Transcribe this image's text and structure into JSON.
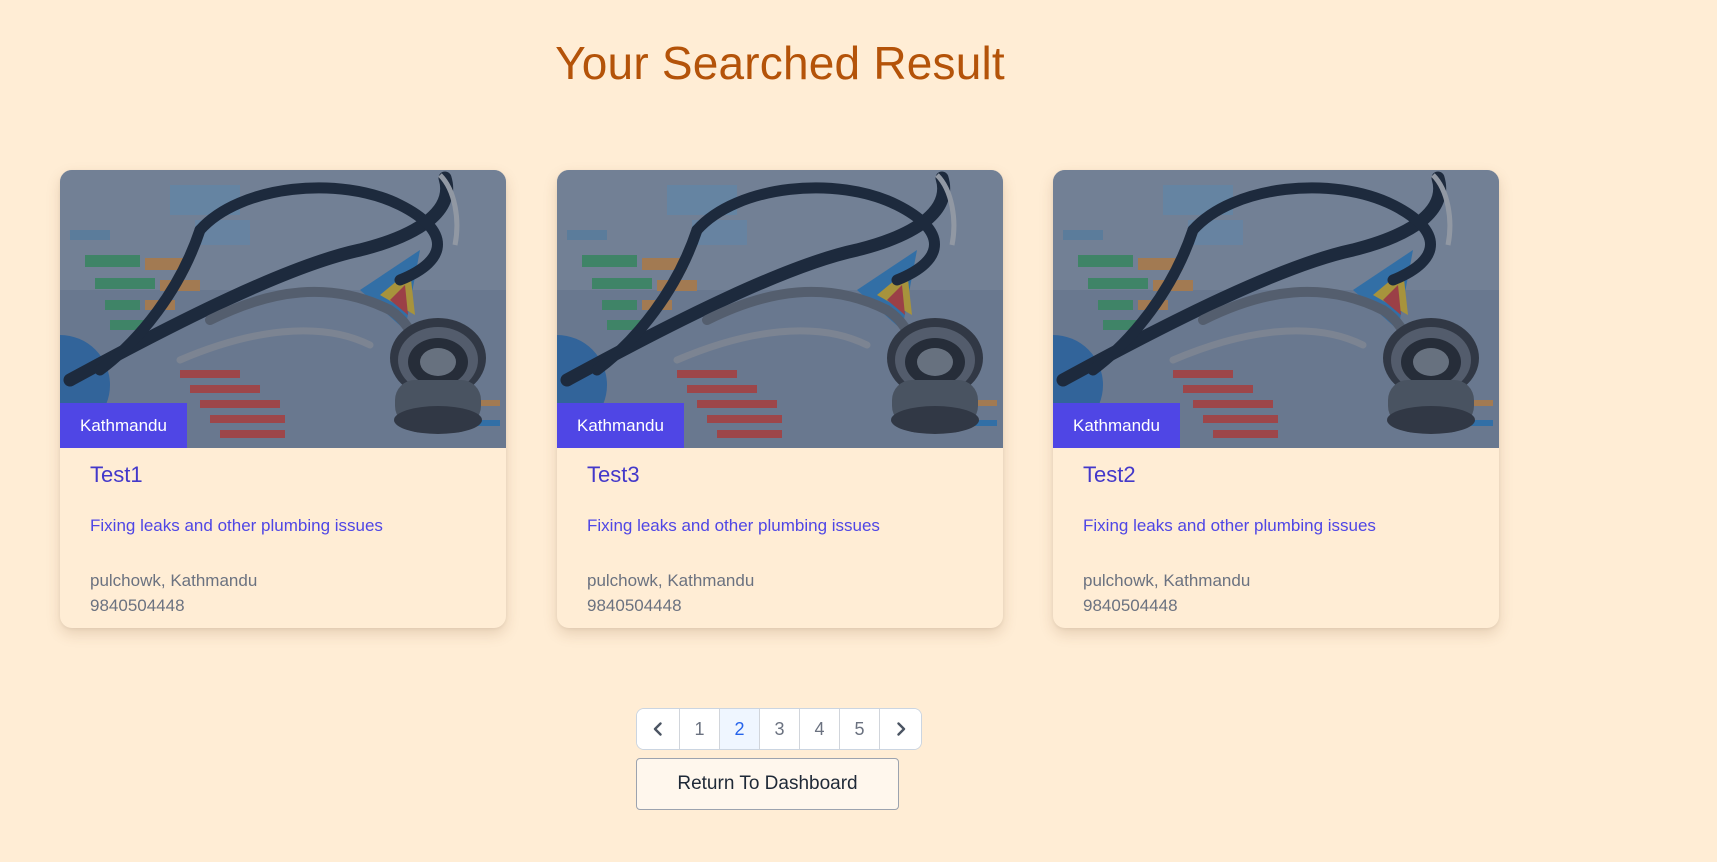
{
  "header": {
    "title": "Your Searched Result"
  },
  "results": [
    {
      "badge": "Kathmandu",
      "title": "Test1",
      "description": "Fixing leaks and other plumbing issues",
      "address": "pulchowk, Kathmandu",
      "phone": "9840504448"
    },
    {
      "badge": "Kathmandu",
      "title": "Test3",
      "description": "Fixing leaks and other plumbing issues",
      "address": "pulchowk, Kathmandu",
      "phone": "9840504448"
    },
    {
      "badge": "Kathmandu",
      "title": "Test2",
      "description": "Fixing leaks and other plumbing issues",
      "address": "pulchowk, Kathmandu",
      "phone": "9840504448"
    }
  ],
  "pagination": {
    "prev_icon": "chevron-left-icon",
    "next_icon": "chevron-right-icon",
    "pages": [
      "1",
      "2",
      "3",
      "4",
      "5"
    ],
    "current_page": "2"
  },
  "actions": {
    "return_label": "Return To Dashboard"
  },
  "colors": {
    "background": "#ffedd5",
    "title": "#b45309",
    "badge": "#4f46e5",
    "card_title": "#4338ca",
    "card_desc": "#4f46e5",
    "muted_text": "#6b7280",
    "active_page": "#2563eb"
  }
}
